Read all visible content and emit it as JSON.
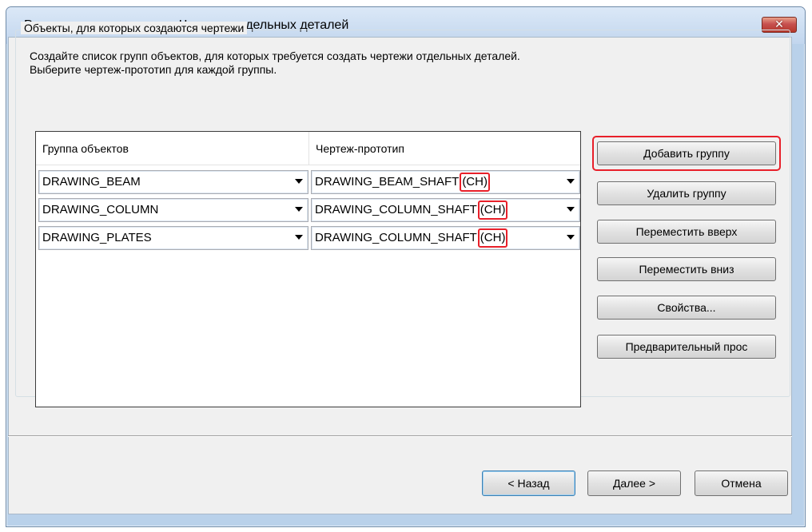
{
  "window": {
    "title": "Редактирование правил - Чертежи отдельных деталей",
    "close_symbol": "✕"
  },
  "groupbox": {
    "legend": "Объекты, для которых создаются чертежи",
    "description_line1": "Создайте список групп объектов, для которых требуется создать чертежи отдельных деталей.",
    "description_line2": "Выберите чертеж-прототип для каждой группы."
  },
  "grid": {
    "columns": [
      "Группа объектов",
      "Чертеж-прототип"
    ],
    "rows": [
      {
        "group": "DRAWING_BEAM",
        "prototype": "DRAWING_BEAM_SHAFT",
        "suffix": "(CH)"
      },
      {
        "group": "DRAWING_COLUMN",
        "prototype": "DRAWING_COLUMN_SHAFT",
        "suffix": "(CH)"
      },
      {
        "group": "DRAWING_PLATES",
        "prototype": "DRAWING_COLUMN_SHAFT",
        "suffix": "(CH)"
      }
    ]
  },
  "side_buttons": {
    "add_group": "Добавить группу",
    "remove_group": "Удалить группу",
    "move_up": "Переместить вверх",
    "move_down": "Переместить вниз",
    "properties": "Свойства...",
    "preview": "Предварительный прос"
  },
  "footer_buttons": {
    "back": "< Назад",
    "next": "Далее >",
    "cancel": "Отмена"
  },
  "colors": {
    "highlight": "#e8202a",
    "window_frame": "#b9d1ea",
    "client_bg": "#f0f0f0"
  },
  "icons": {
    "close": "close-icon",
    "dropdown": "chevron-down-icon"
  }
}
